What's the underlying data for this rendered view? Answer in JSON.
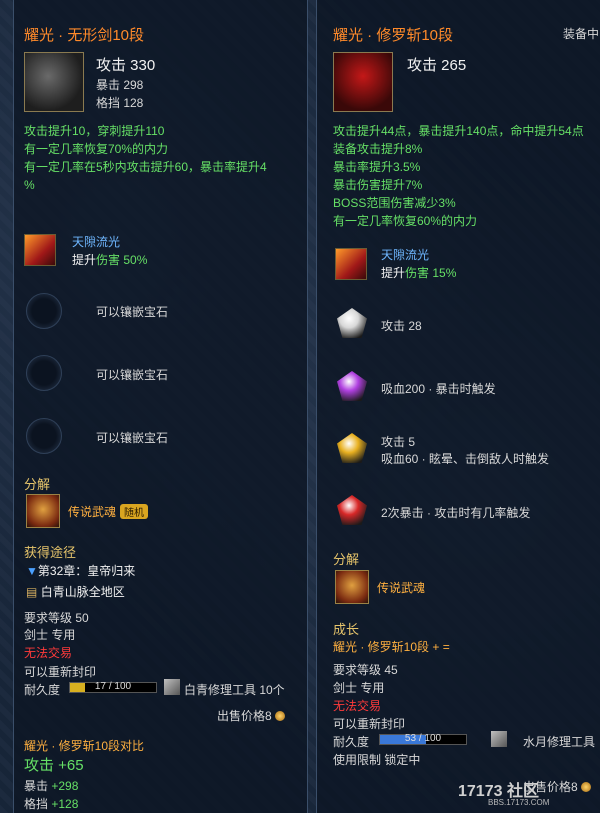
{
  "left": {
    "title": "耀光 · 无形剑10段",
    "attack_label": "攻击 330",
    "crit_label": "暴击 298",
    "block_label": "格挡 128",
    "effects": [
      "攻击提升10，穿刺提升110",
      "有一定几率恢复70%的内力",
      "有一定几率在5秒内攻击提升60，暴击率提升4",
      "%"
    ],
    "skill": {
      "name": "天隙流光",
      "line_prefix": "提升",
      "line_value": "伤害 50%"
    },
    "sockets": [
      "可以镶嵌宝石",
      "可以镶嵌宝石",
      "可以镶嵌宝石"
    ],
    "decompose_label": "分解",
    "decompose_item": "传说武魂",
    "decompose_badge": "随机",
    "source_label": "获得途径",
    "sources": [
      "第32章：皇帝归来",
      "白青山脉全地区"
    ],
    "req_level": "要求等级 50",
    "class_only": "剑士 专用",
    "no_trade": "无法交易",
    "reseal": "可以重新封印",
    "durability_label": "耐久度",
    "durability_text": "17 / 100",
    "durability_value": 0.17,
    "repair_tool": "白青修理工具 10个",
    "sell_price": "出售价格8",
    "compare_title": "耀光 · 修罗斩10段对比",
    "compare_attack": "攻击 +65",
    "compare_crit_label": "暴击",
    "compare_crit": "+298",
    "compare_block_label": "格挡",
    "compare_block": "+128"
  },
  "right": {
    "title": "耀光 · 修罗斩10段",
    "equipped": "装备中",
    "attack_label": "攻击 265",
    "effects": [
      "攻击提升44点，暴击提升140点，命中提升54点",
      "装备攻击提升8%",
      "暴击率提升3.5%",
      "暴击伤害提升7%",
      "BOSS范围伤害减少3%",
      "有一定几率恢复60%的内力"
    ],
    "skill": {
      "name": "天隙流光",
      "line_prefix": "提升",
      "line_value": "伤害 15%"
    },
    "gems": [
      {
        "text": "攻击 28",
        "text2": "",
        "color": "#d8d8d8"
      },
      {
        "text": "吸血200 · 暴击时触发",
        "text2": "",
        "color": "#b040e0"
      },
      {
        "text": "攻击 5",
        "text2": "吸血60 · 眩晕、击倒敌人时触发",
        "color": "#e8b020"
      },
      {
        "text": "2次暴击 · 攻击时有几率触发",
        "text2": "",
        "color": "#d82828"
      }
    ],
    "decompose_label": "分解",
    "decompose_item": "传说武魂",
    "growth_label": "成长",
    "growth_line": "耀光 · 修罗斩10段 + =",
    "req_level": "要求等级 45",
    "class_only": "剑士 专用",
    "no_trade": "无法交易",
    "reseal": "可以重新封印",
    "durability_label": "耐久度",
    "durability_text": "53 / 100",
    "durability_value": 0.53,
    "repair_tool": "水月修理工具",
    "restriction": "使用限制 锁定中",
    "sell_price": "出售价格8"
  },
  "watermark": {
    "logo": "17173 社区",
    "url": "BBS.17173.COM"
  }
}
